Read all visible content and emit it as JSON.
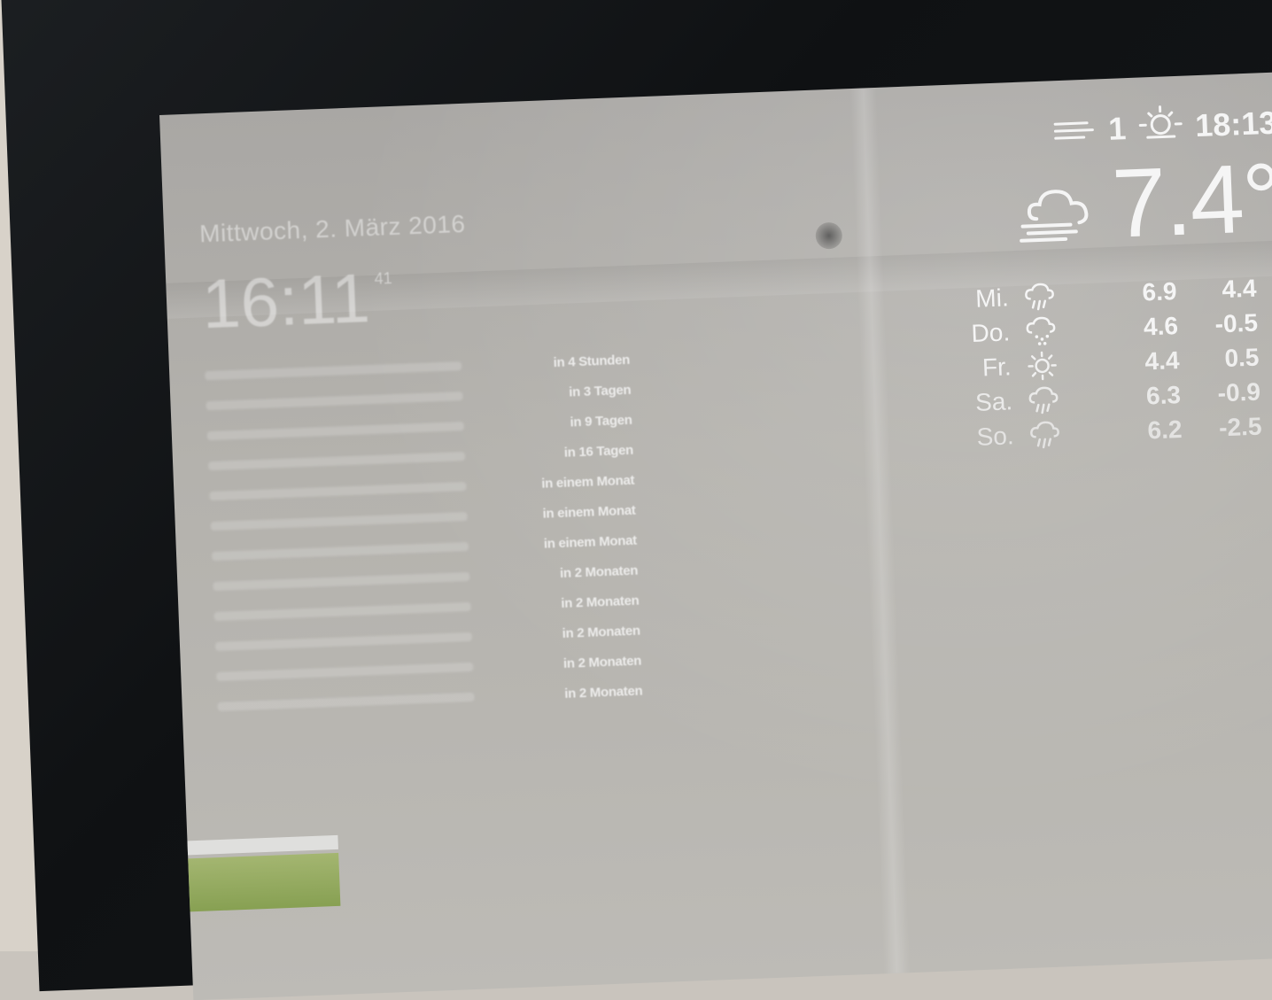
{
  "clock": {
    "date": "Mittwoch, 2. März 2016",
    "time": "16:11",
    "seconds": "41"
  },
  "calendar": {
    "events": [
      {
        "relative": "in 4 Stunden"
      },
      {
        "relative": "in 3 Tagen"
      },
      {
        "relative": "in 9 Tagen"
      },
      {
        "relative": "in 16 Tagen"
      },
      {
        "relative": "in einem Monat"
      },
      {
        "relative": "in einem Monat"
      },
      {
        "relative": "in einem Monat"
      },
      {
        "relative": "in 2 Monaten"
      },
      {
        "relative": "in 2 Monaten"
      },
      {
        "relative": "in 2 Monaten"
      },
      {
        "relative": "in 2 Monaten"
      },
      {
        "relative": "in 2 Monaten"
      }
    ]
  },
  "weather": {
    "wind": "1",
    "wind_icon": "wind-icon",
    "sun_icon": "sunset-icon",
    "sun_time": "18:13",
    "current_icon": "windy-cloud-icon",
    "current_temp": "7.4°",
    "forecast": [
      {
        "day": "Mi.",
        "icon": "rain-icon",
        "max": "6.9",
        "min": "4.4"
      },
      {
        "day": "Do.",
        "icon": "sleet-icon",
        "max": "4.6",
        "min": "-0.5"
      },
      {
        "day": "Fr.",
        "icon": "sun-icon",
        "max": "4.4",
        "min": "0.5"
      },
      {
        "day": "Sa.",
        "icon": "rain-icon",
        "max": "6.3",
        "min": "-0.9"
      },
      {
        "day": "So.",
        "icon": "rain-icon",
        "max": "6.2",
        "min": "-2.5"
      }
    ]
  }
}
